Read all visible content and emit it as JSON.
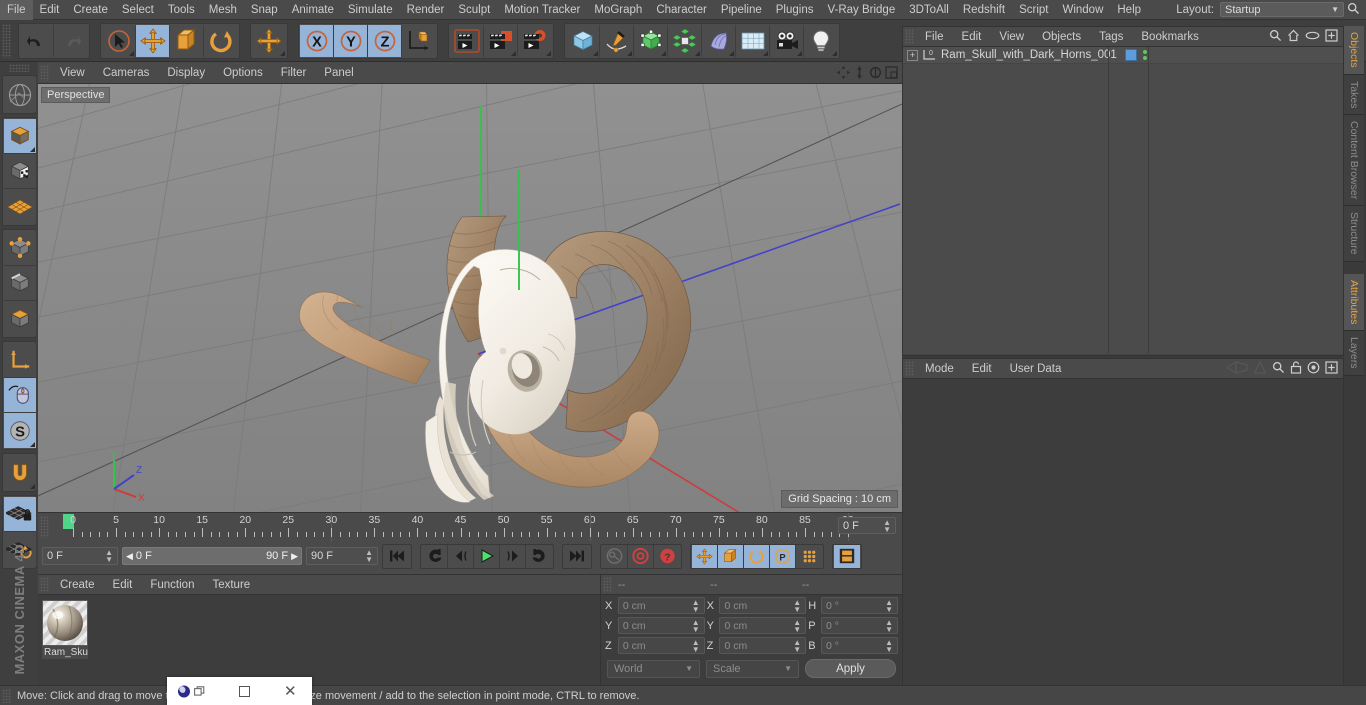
{
  "app": {
    "name": "MAXON CINEMA 4D",
    "logo_text": "MAXON CINEMA 4D"
  },
  "menubar": {
    "items": [
      "File",
      "Edit",
      "Create",
      "Select",
      "Tools",
      "Mesh",
      "Snap",
      "Animate",
      "Simulate",
      "Render",
      "Sculpt",
      "Motion Tracker",
      "MoGraph",
      "Character",
      "Pipeline",
      "Plugins",
      "V-Ray Bridge",
      "3DToAll",
      "Redshift",
      "Script",
      "Window",
      "Help"
    ],
    "layout_label": "Layout:",
    "layout_value": "Startup",
    "search_icon": "search-icon"
  },
  "toolbar": {
    "groups": [
      {
        "name": "history",
        "buttons": [
          {
            "icon": "undo-icon",
            "label": "Undo",
            "selected": false
          },
          {
            "icon": "redo-icon",
            "label": "Redo",
            "selected": false,
            "disabled": true
          }
        ]
      },
      {
        "name": "tools",
        "buttons": [
          {
            "icon": "select-cursor-icon",
            "label": "Live Selection",
            "selected": false,
            "corner": true
          },
          {
            "icon": "move-icon",
            "label": "Move",
            "selected": true
          },
          {
            "icon": "scale-icon",
            "label": "Scale",
            "selected": false
          },
          {
            "icon": "rotate-icon",
            "label": "Rotate",
            "selected": false
          }
        ]
      },
      {
        "name": "move-standalone",
        "buttons": [
          {
            "icon": "move-icon",
            "label": "Move",
            "selected": false,
            "corner": true
          }
        ]
      },
      {
        "name": "axis-locks",
        "buttons": [
          {
            "icon": "x-axis-icon",
            "label": "X",
            "selected": true
          },
          {
            "icon": "y-axis-icon",
            "label": "Y",
            "selected": true
          },
          {
            "icon": "z-axis-icon",
            "label": "Z",
            "selected": true
          },
          {
            "icon": "world-coordinates-icon",
            "label": "World/Object",
            "selected": false
          }
        ]
      },
      {
        "name": "render",
        "buttons": [
          {
            "icon": "render-view-icon",
            "label": "Render View",
            "selected": false
          },
          {
            "icon": "render-region-icon",
            "label": "Render to Picture Viewer",
            "selected": false,
            "corner": true
          },
          {
            "icon": "render-settings-icon",
            "label": "Render Settings",
            "selected": false,
            "corner": true
          }
        ]
      },
      {
        "name": "objects",
        "buttons": [
          {
            "icon": "cube-primitive-icon",
            "label": "Add Cube",
            "selected": false,
            "corner": true
          },
          {
            "icon": "spline-pen-icon",
            "label": "Add Spline",
            "selected": false,
            "corner": true
          },
          {
            "icon": "generator-icon",
            "label": "Add Generator",
            "selected": false,
            "corner": true
          },
          {
            "icon": "mograph-icon",
            "label": "MoGraph",
            "selected": false,
            "corner": true
          },
          {
            "icon": "deformer-icon",
            "label": "Add Deformer",
            "selected": false,
            "corner": true
          },
          {
            "icon": "scene-floor-icon",
            "label": "Scene Object",
            "selected": false,
            "corner": true
          },
          {
            "icon": "camera-icon",
            "label": "Add Camera",
            "selected": false,
            "corner": true
          },
          {
            "icon": "light-icon",
            "label": "Add Light",
            "selected": false,
            "corner": true
          }
        ]
      }
    ]
  },
  "left_toolbar": {
    "groups": [
      {
        "buttons": [
          {
            "icon": "globe-axis-icon",
            "label": "Make Editable",
            "selected": false
          }
        ]
      },
      {
        "buttons": [
          {
            "icon": "model-mode-icon",
            "label": "Model Mode",
            "selected": true,
            "corner": true
          },
          {
            "icon": "texture-mode-icon",
            "label": "Texture Mode",
            "selected": false
          },
          {
            "icon": "workplane-icon",
            "label": "Workplane",
            "selected": false
          }
        ]
      },
      {
        "buttons": [
          {
            "icon": "points-mode-icon",
            "label": "Points",
            "selected": false
          },
          {
            "icon": "edges-mode-icon",
            "label": "Edges",
            "selected": false
          },
          {
            "icon": "polygons-mode-icon",
            "label": "Polygons",
            "selected": false
          }
        ]
      },
      {
        "buttons": [
          {
            "icon": "axis-modify-icon",
            "label": "Enable Axis Modification",
            "selected": false
          },
          {
            "icon": "mouse-icon",
            "label": "Viewport Solo",
            "selected": true
          },
          {
            "icon": "soft-selection-icon",
            "label": "Soft Selection",
            "selected": true,
            "corner": true
          }
        ]
      },
      {
        "buttons": [
          {
            "icon": "magnet-icon",
            "label": "Magnet",
            "selected": false,
            "corner": true
          }
        ]
      },
      {
        "buttons": [
          {
            "icon": "workplane-lock-icon",
            "label": "Lock Workplane",
            "selected": true
          },
          {
            "icon": "workplane-reset-icon",
            "label": "Planar Workplane",
            "selected": false
          }
        ]
      }
    ]
  },
  "viewport": {
    "menu": [
      "View",
      "Cameras",
      "Display",
      "Options",
      "Filter",
      "Panel"
    ],
    "nav_icons": [
      "pan-icon",
      "zoom-icon",
      "orbit-icon",
      "maximize-viewport-icon"
    ],
    "label": "Perspective",
    "grid_spacing": "Grid Spacing : 10 cm",
    "axis_labels": {
      "x": "X",
      "y": "Y",
      "z": "Z"
    },
    "colors": {
      "background": "#8a8a8a",
      "x_axis": "#cc4444",
      "y_axis": "#49c24b",
      "z_axis": "#4a4acc"
    }
  },
  "timeline": {
    "ticks": [
      "0",
      "5",
      "10",
      "15",
      "20",
      "25",
      "30",
      "35",
      "40",
      "45",
      "50",
      "55",
      "60",
      "65",
      "70",
      "75",
      "80",
      "85",
      "90"
    ],
    "current_frame_field": "0 F",
    "frame_start": "0 F",
    "range_start": "0 F",
    "range_end": "90 F",
    "frame_end": "90 F",
    "playback_buttons": [
      {
        "icon": "go-to-start-icon",
        "label": "Go to Start",
        "selected": false
      },
      {
        "icon": "rewind-icon",
        "label": "Go to Previous Keyframe",
        "selected": false
      },
      {
        "icon": "step-back-icon",
        "label": "Go to Previous Frame",
        "selected": false
      },
      {
        "icon": "play-icon",
        "label": "Play",
        "selected": false
      },
      {
        "icon": "step-forward-icon",
        "label": "Go to Next Frame",
        "selected": false
      },
      {
        "icon": "forward-icon",
        "label": "Go to Next Keyframe",
        "selected": false
      },
      {
        "icon": "go-to-end-icon",
        "label": "Go to End",
        "selected": false
      }
    ],
    "record_buttons": [
      {
        "icon": "autokey-icon",
        "label": "Autokeying",
        "selected": false
      },
      {
        "icon": "record-icon",
        "label": "Record Active Objects",
        "selected": false
      },
      {
        "icon": "keyframe-selection-icon",
        "label": "Keyframe Selection",
        "selected": false
      }
    ],
    "key_filter_buttons": [
      {
        "icon": "key-position-icon",
        "label": "Position",
        "selected": true
      },
      {
        "icon": "key-scale-icon",
        "label": "Scale",
        "selected": true
      },
      {
        "icon": "key-rotation-icon",
        "label": "Rotation",
        "selected": true
      },
      {
        "icon": "key-param-icon",
        "label": "Parameter",
        "selected": true
      },
      {
        "icon": "key-pla-icon",
        "label": "Point Level Animation",
        "selected": false
      }
    ],
    "timeline_toggle": {
      "icon": "timeline-icon",
      "label": "Timeline",
      "selected": true
    }
  },
  "material_manager": {
    "menu": [
      "Create",
      "Edit",
      "Function",
      "Texture"
    ],
    "materials": [
      {
        "name": "Ram_Sku",
        "full_name": "Ram_Skull"
      }
    ]
  },
  "coordinates": {
    "header": [
      "--",
      "--",
      "--"
    ],
    "rows": [
      {
        "pos_label": "X",
        "pos_value": "0 cm",
        "size_label": "X",
        "size_value": "0 cm",
        "rot_label": "H",
        "rot_value": "0 °"
      },
      {
        "pos_label": "Y",
        "pos_value": "0 cm",
        "size_label": "Y",
        "size_value": "0 cm",
        "rot_label": "P",
        "rot_value": "0 °"
      },
      {
        "pos_label": "Z",
        "pos_value": "0 cm",
        "size_label": "Z",
        "size_value": "0 cm",
        "rot_label": "B",
        "rot_value": "0 °"
      }
    ],
    "system": "World",
    "mode": "Scale",
    "apply": "Apply"
  },
  "object_manager": {
    "menu": [
      "File",
      "Edit",
      "View",
      "Objects",
      "Tags",
      "Bookmarks"
    ],
    "tool_icons": [
      "search-icon",
      "home-icon",
      "eye-icon",
      "add-layer-icon"
    ],
    "objects": [
      {
        "name": "Ram_Skull_with_Dark_Horns_001",
        "layer_badge": "0",
        "expander": "+",
        "chip_color": "#5d9ddb"
      }
    ]
  },
  "attributes": {
    "menu": [
      "Mode",
      "Edit",
      "User Data"
    ],
    "tool_icons": [
      "prev-icon",
      "next-icon",
      "search-icon",
      "lock-icon",
      "target-icon",
      "add-icon"
    ]
  },
  "right_tabs": {
    "top": [
      {
        "label": "Objects",
        "active": true
      },
      {
        "label": "Takes",
        "active": false
      },
      {
        "label": "Content Browser",
        "active": false
      },
      {
        "label": "Structure",
        "active": false
      }
    ],
    "bottom": [
      {
        "label": "Attributes",
        "active": true
      },
      {
        "label": "Layers",
        "active": false
      }
    ]
  },
  "statusbar": {
    "text": "Move: Click and drag to move the selection. SHIFT to quantize movement / add to the selection in point mode, CTRL to remove."
  },
  "taskbar_popup": {
    "app_icon": "cinema4d-icon",
    "restore_icon": "restore-window-icon",
    "maximize_icon": "maximize-window-icon",
    "close_icon": "close-window-icon"
  }
}
